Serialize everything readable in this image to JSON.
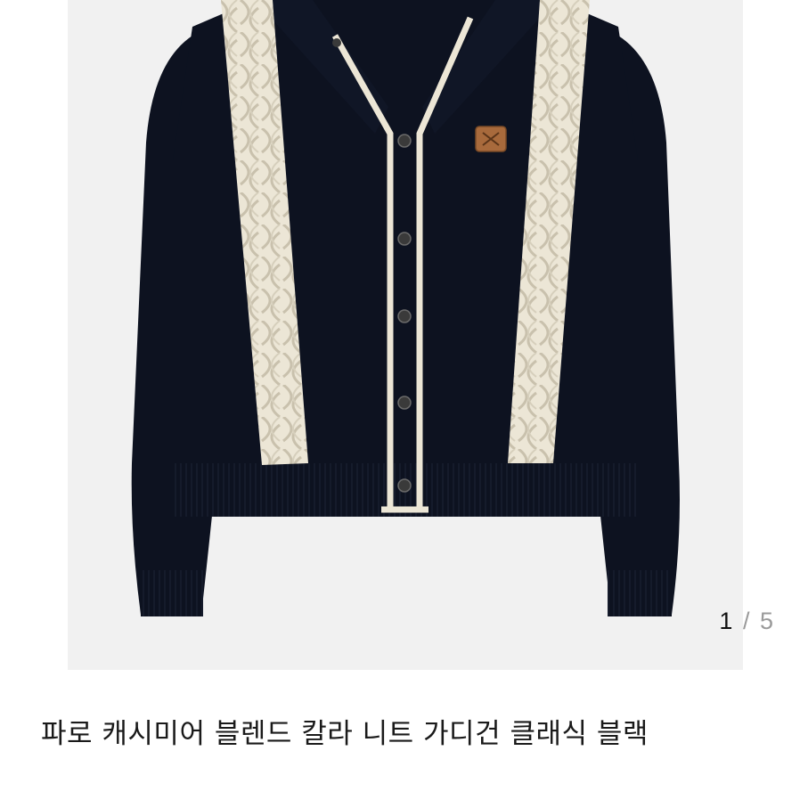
{
  "gallery": {
    "image_alt": "black cardigan with cream cable knit stripes",
    "counter": {
      "current": "1",
      "separator": "/",
      "total": "5"
    }
  },
  "product": {
    "title": "파로 캐시미어 블렌드 칼라 니트 가디건 클래식 블랙"
  },
  "colors": {
    "garment": "#0d1220",
    "cable": "#ece6d6",
    "photo_bg": "#f1f1f1",
    "button": "#3a3a3a",
    "patch": "#a86a3c"
  }
}
